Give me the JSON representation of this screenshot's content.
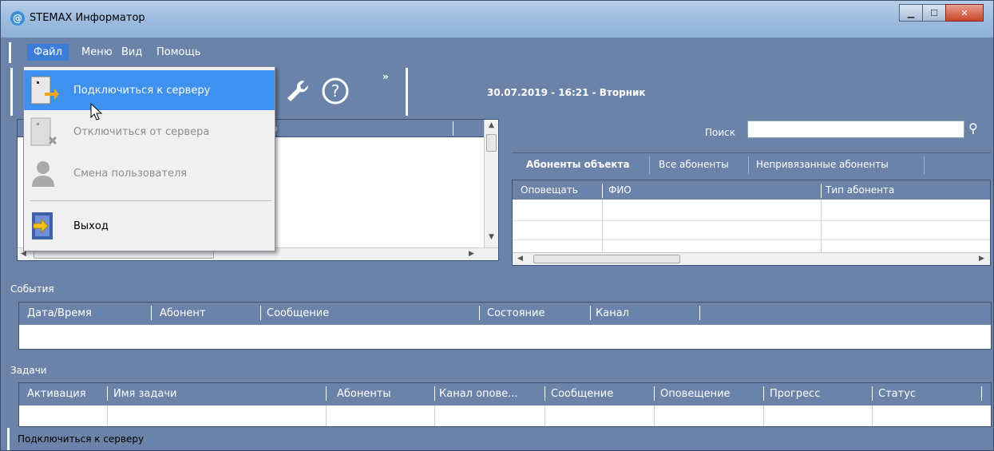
{
  "window": {
    "title": "STEMAX Информатор",
    "icon": "at-icon",
    "controls": [
      "minimize",
      "maximize",
      "close"
    ]
  },
  "menubar": {
    "items": [
      "Файл",
      "Меню",
      "Вид",
      "Помощь"
    ],
    "active": "Файл"
  },
  "toolbar": {
    "icons": [
      "wrench-icon",
      "help-icon"
    ],
    "overflow": "»",
    "datetime": "30.07.2019 - 16:21 - Вторник"
  },
  "file_menu": {
    "items": [
      {
        "label": "Подключиться к серверу",
        "icon": "server-connect-icon",
        "enabled": true,
        "highlighted": true
      },
      {
        "label": "Отключиться от сервера",
        "icon": "server-disconnect-icon",
        "enabled": false
      },
      {
        "label": "Смена пользователя",
        "icon": "change-user-icon",
        "enabled": false
      },
      {
        "label": "Выход",
        "icon": "exit-door-icon",
        "enabled": true
      }
    ]
  },
  "left_table": {
    "partial_header": "о"
  },
  "search": {
    "label": "Поиск",
    "value": ""
  },
  "subscriber_tabs": [
    "Абоненты объекта",
    "Все абоненты",
    "Непривязанные абоненты"
  ],
  "subscriber_columns": [
    "Оповещать",
    "ФИО",
    "Тип абонента"
  ],
  "events": {
    "label": "События",
    "columns": [
      "Дата/Время",
      "Абонент",
      "Сообщение",
      "Состояние",
      "Канал"
    ]
  },
  "tasks": {
    "label": "Задачи",
    "columns": [
      "Активация",
      "Имя задачи",
      "Абоненты",
      "Канал опове...",
      "Сообщение",
      "Оповещение",
      "Прогресс",
      "Статус"
    ]
  },
  "status": {
    "text": "Подключиться к серверу"
  },
  "colors": {
    "panel_bg": "#6b83a8",
    "menu_highlight": "#3e91ee",
    "disabled_text": "#8c8c8c"
  }
}
